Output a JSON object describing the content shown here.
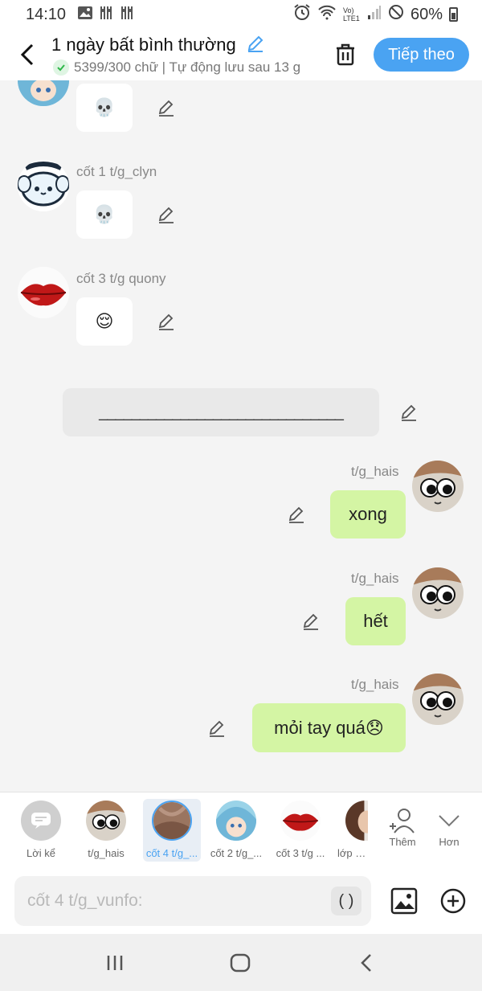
{
  "status_bar": {
    "time": "14:10",
    "network": "Vo) LTE1",
    "battery": "60%"
  },
  "header": {
    "title": "1 ngày bất bình thường",
    "subtitle": "5399/300 chữ | Tự động lưu sau 13 g",
    "next_label": "Tiếp theo"
  },
  "messages": [
    {
      "sender": "",
      "text": "💀",
      "side": "left",
      "avatar": "anime-girl-blue-hair"
    },
    {
      "sender": "cốt 1 t/g_clyn",
      "text": "💀",
      "side": "left",
      "avatar": "cinnamoroll"
    },
    {
      "sender": "cốt 3 t/g quony",
      "text": "😌",
      "side": "left",
      "avatar": "red-lips"
    },
    {
      "divider": "______________________________"
    },
    {
      "sender": "t/g_hais",
      "text": "xong",
      "side": "right",
      "avatar": "cat-googly-eyes"
    },
    {
      "sender": "t/g_hais",
      "text": "hết",
      "side": "right",
      "avatar": "cat-googly-eyes"
    },
    {
      "sender": "t/g_hais",
      "text": "mỏi tay quá😞",
      "side": "right",
      "avatar": "cat-googly-eyes"
    }
  ],
  "characters": [
    {
      "label": "Lời kể",
      "icon": "narration-icon"
    },
    {
      "label": "t/g_hais",
      "icon": "cat-googly-eyes"
    },
    {
      "label": "cốt 4 t/g_...",
      "icon": "skin-photo",
      "selected": true
    },
    {
      "label": "cốt 2 t/g_...",
      "icon": "anime-girl-blue-hair"
    },
    {
      "label": "cốt 3 t/g ...",
      "icon": "red-lips"
    },
    {
      "label": "lớp trư",
      "icon": "partial-avatar"
    },
    {
      "label": "Thêm",
      "icon": "add-person-icon"
    },
    {
      "label": "Hơn",
      "icon": "chevron-down-icon"
    }
  ],
  "input": {
    "placeholder": "cốt 4 t/g_vunfo:",
    "paren_label": "( )"
  },
  "colors": {
    "accent": "#4aa3f2",
    "right_bubble": "#d4f5a4",
    "left_bubble": "#ffffff",
    "background": "#f4f4f4"
  }
}
